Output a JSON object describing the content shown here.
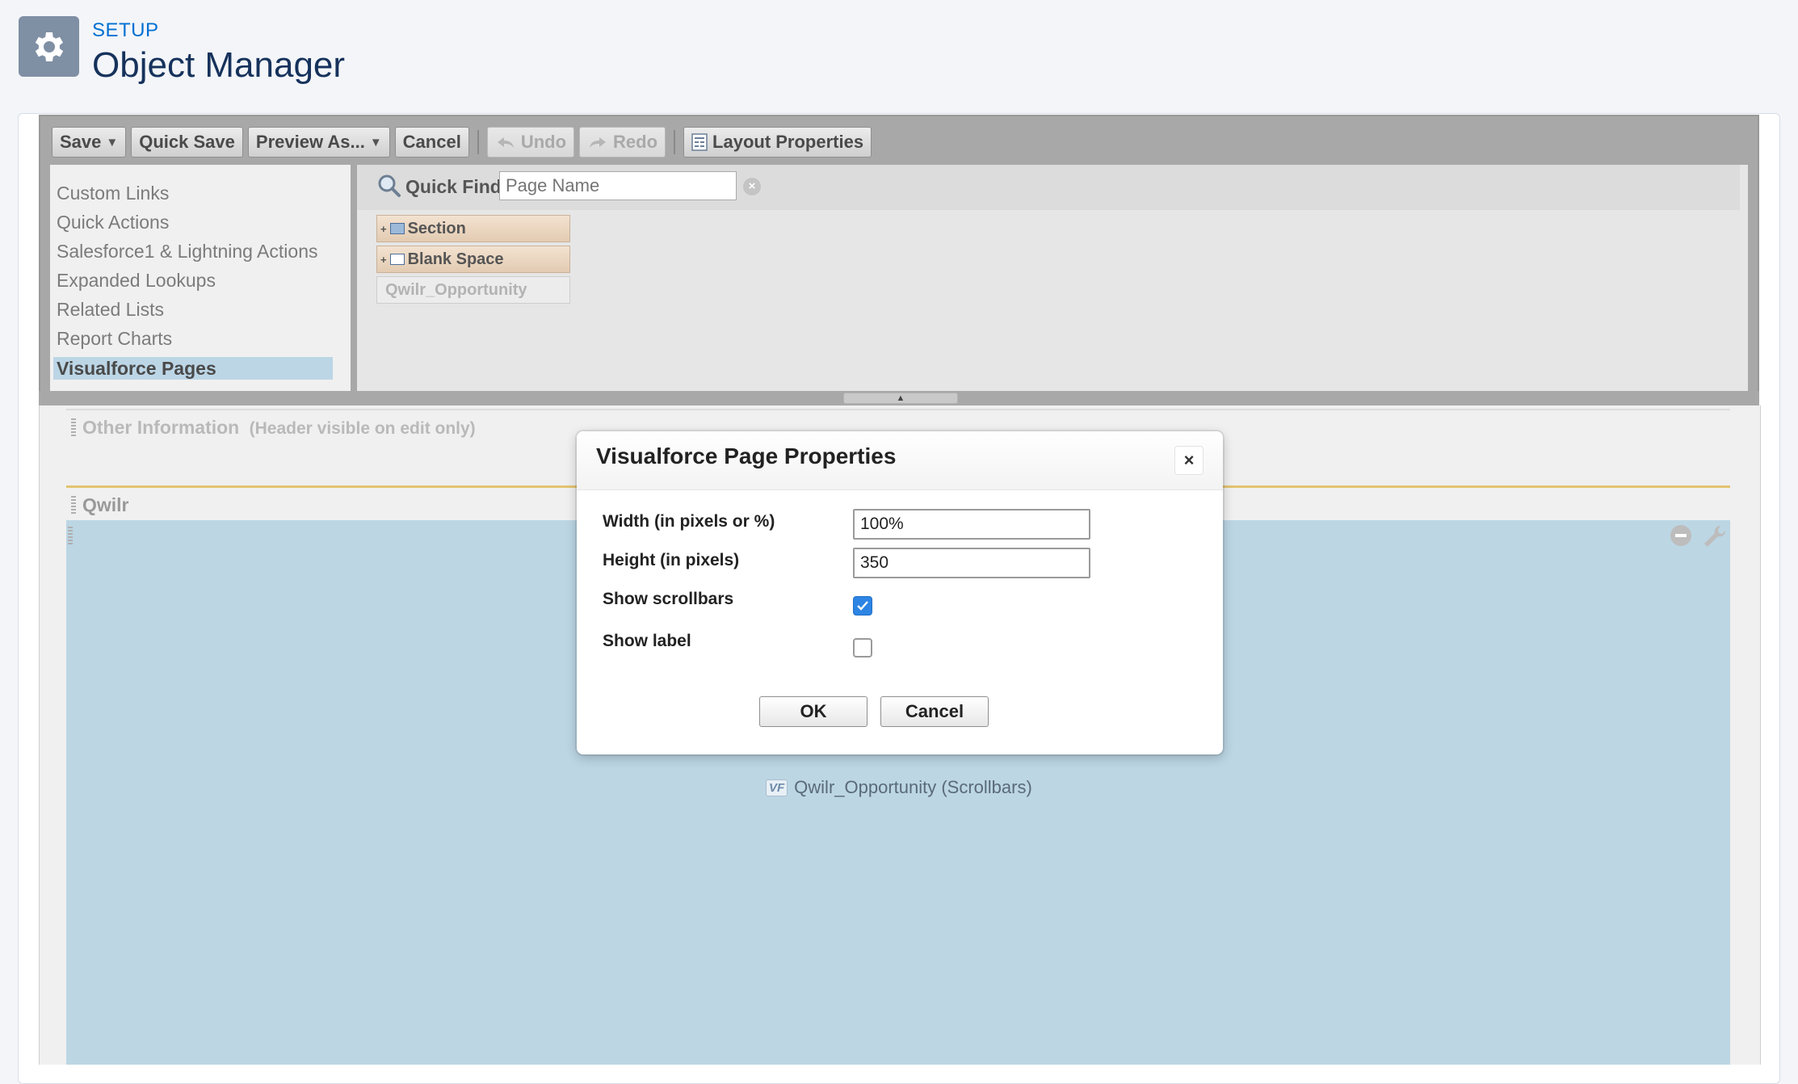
{
  "header": {
    "setup_label": "SETUP",
    "title": "Object Manager"
  },
  "toolbar": {
    "save": "Save",
    "quick_save": "Quick Save",
    "preview_as": "Preview As...",
    "cancel": "Cancel",
    "undo": "Undo",
    "redo": "Redo",
    "layout_properties": "Layout Properties"
  },
  "palette_categories": [
    "Custom Links",
    "Quick Actions",
    "Salesforce1 & Lightning Actions",
    "Expanded Lookups",
    "Related Lists",
    "Report Charts",
    "Visualforce Pages"
  ],
  "quick_find": {
    "label": "Quick Find",
    "placeholder": "Page Name"
  },
  "palette_items": {
    "section": "Section",
    "blank_space": "Blank Space",
    "vf_page": "Qwilr_Opportunity"
  },
  "layout": {
    "other_section_title": "Other Information",
    "other_section_note": "(Header visible on edit only)",
    "qwilr_section_title": "Qwilr",
    "vf_badge": "VF",
    "vf_item_label": "Qwilr_Opportunity (Scrollbars)"
  },
  "modal": {
    "title": "Visualforce Page Properties",
    "close_glyph": "×",
    "width_label": "Width (in pixels or %)",
    "width_value": "100%",
    "height_label": "Height (in pixels)",
    "height_value": "350",
    "scrollbars_label": "Show scrollbars",
    "scrollbars_checked": true,
    "label_label": "Show label",
    "label_checked": false,
    "ok": "OK",
    "cancel": "Cancel"
  }
}
